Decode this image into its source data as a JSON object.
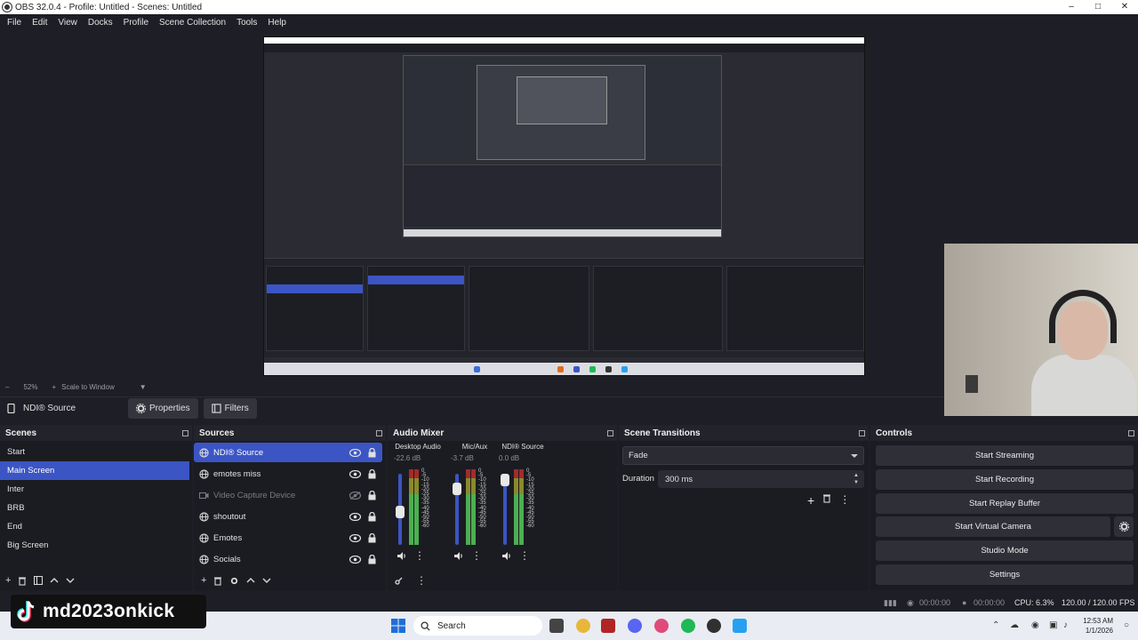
{
  "window": {
    "title": "OBS 32.0.4 - Profile: Untitled - Scenes: Untitled",
    "minimize": "–",
    "maximize": "□",
    "close": "✕"
  },
  "menu": [
    "File",
    "Edit",
    "View",
    "Docks",
    "Profile",
    "Scene Collection",
    "Tools",
    "Help"
  ],
  "preview": {
    "zoom": "52%",
    "scale_mode": "Scale to Window"
  },
  "source_toolbar": {
    "current_source": "NDI® Source",
    "properties_label": "Properties",
    "filters_label": "Filters"
  },
  "scenes": {
    "title": "Scenes",
    "items": [
      "Start",
      "Main Screen",
      "Inter",
      "BRB",
      "End",
      "Big Screen"
    ],
    "selected_index": 1
  },
  "sources": {
    "title": "Sources",
    "items": [
      {
        "name": "NDI® Source",
        "icon": "globe-icon",
        "visible": true,
        "selected": true
      },
      {
        "name": "emotes miss",
        "icon": "globe-icon",
        "visible": true,
        "selected": false
      },
      {
        "name": "Video Capture Device",
        "icon": "camera-icon",
        "visible": false,
        "selected": false
      },
      {
        "name": "shoutout",
        "icon": "globe-icon",
        "visible": true,
        "selected": false
      },
      {
        "name": "Emotes",
        "icon": "globe-icon",
        "visible": true,
        "selected": false
      },
      {
        "name": "Socials",
        "icon": "globe-icon",
        "visible": true,
        "selected": false
      }
    ]
  },
  "audio_mixer": {
    "title": "Audio Mixer",
    "scale": [
      "0",
      "-5",
      "-10",
      "-15",
      "-20",
      "-25",
      "-30",
      "-35",
      "-40",
      "-45",
      "-50",
      "-55",
      "-60"
    ],
    "channels": [
      {
        "name": "Desktop Audio",
        "db": "-22.6 dB",
        "fader_level": 0.45
      },
      {
        "name": "Mic/Aux",
        "db": "-3.7 dB",
        "fader_level": 0.85
      },
      {
        "name": "NDI® Source",
        "db": "0.0 dB",
        "fader_level": 1.0
      }
    ]
  },
  "scene_transitions": {
    "title": "Scene Transitions",
    "transition": "Fade",
    "duration_label": "Duration",
    "duration_value": "300 ms"
  },
  "controls": {
    "title": "Controls",
    "buttons": [
      "Start Streaming",
      "Start Recording",
      "Start Replay Buffer",
      "Start Virtual Camera",
      "Studio Mode",
      "Settings"
    ]
  },
  "status": {
    "stream_time": "00:00:00",
    "record_time": "00:00:00",
    "cpu": "CPU: 6.3%",
    "fps": "120.00 / 120.00 FPS"
  },
  "taskbar": {
    "search_placeholder": "Search",
    "time": "12:53 AM",
    "date": "1/1/2026"
  },
  "watermark": {
    "text": "md2023onkick"
  },
  "colors": {
    "accent": "#3b55c4",
    "background": "#1e1f26",
    "dock": "#1b1c21"
  }
}
